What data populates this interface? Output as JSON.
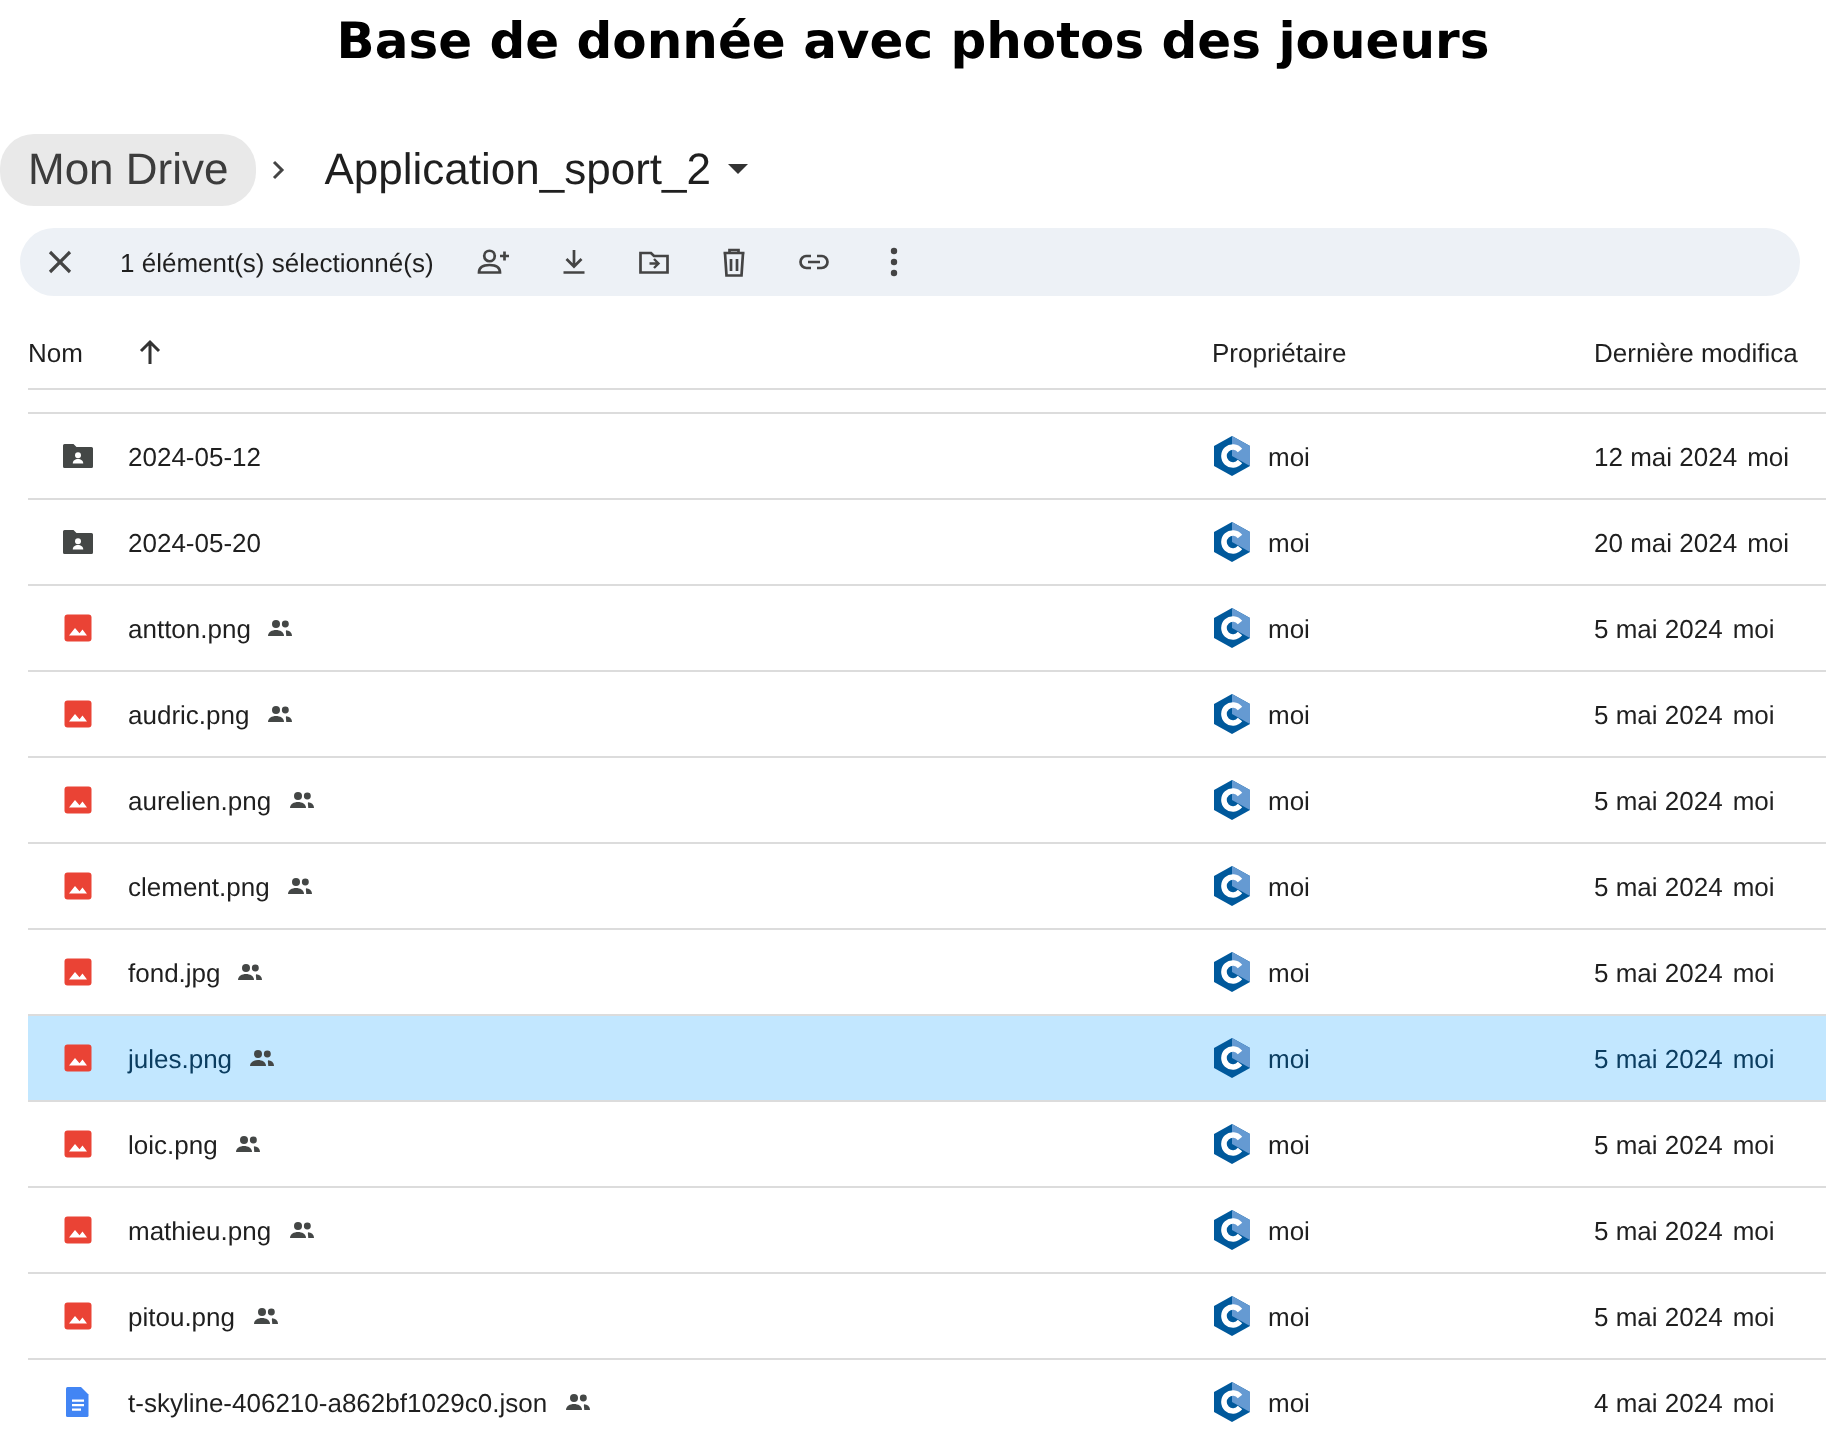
{
  "heading": "Base de donnée avec photos des joueurs",
  "breadcrumb": {
    "root": "Mon Drive",
    "current": "Application_sport_2"
  },
  "selection_bar": {
    "label": "1 élément(s) sélectionné(s)"
  },
  "table": {
    "columns": [
      "Nom",
      "Propriétaire",
      "Dernière modifica"
    ],
    "rows": [
      {
        "kind": "folder",
        "name": "2024-05-12",
        "shared": false,
        "owner": "moi",
        "modified": "12 mai 2024",
        "modified_by": "moi",
        "selected": false
      },
      {
        "kind": "folder",
        "name": "2024-05-20",
        "shared": false,
        "owner": "moi",
        "modified": "20 mai 2024",
        "modified_by": "moi",
        "selected": false
      },
      {
        "kind": "image",
        "name": "antton.png",
        "shared": true,
        "owner": "moi",
        "modified": "5 mai 2024",
        "modified_by": "moi",
        "selected": false
      },
      {
        "kind": "image",
        "name": "audric.png",
        "shared": true,
        "owner": "moi",
        "modified": "5 mai 2024",
        "modified_by": "moi",
        "selected": false
      },
      {
        "kind": "image",
        "name": "aurelien.png",
        "shared": true,
        "owner": "moi",
        "modified": "5 mai 2024",
        "modified_by": "moi",
        "selected": false
      },
      {
        "kind": "image",
        "name": "clement.png",
        "shared": true,
        "owner": "moi",
        "modified": "5 mai 2024",
        "modified_by": "moi",
        "selected": false
      },
      {
        "kind": "image",
        "name": "fond.jpg",
        "shared": true,
        "owner": "moi",
        "modified": "5 mai 2024",
        "modified_by": "moi",
        "selected": false
      },
      {
        "kind": "image",
        "name": "jules.png",
        "shared": true,
        "owner": "moi",
        "modified": "5 mai 2024",
        "modified_by": "moi",
        "selected": true
      },
      {
        "kind": "image",
        "name": "loic.png",
        "shared": true,
        "owner": "moi",
        "modified": "5 mai 2024",
        "modified_by": "moi",
        "selected": false
      },
      {
        "kind": "image",
        "name": "mathieu.png",
        "shared": true,
        "owner": "moi",
        "modified": "5 mai 2024",
        "modified_by": "moi",
        "selected": false
      },
      {
        "kind": "image",
        "name": "pitou.png",
        "shared": true,
        "owner": "moi",
        "modified": "5 mai 2024",
        "modified_by": "moi",
        "selected": false
      },
      {
        "kind": "document",
        "name": "t-skyline-406210-a862bf1029c0.json",
        "shared": true,
        "owner": "moi",
        "modified": "4 mai 2024",
        "modified_by": "moi",
        "selected": false
      }
    ]
  }
}
